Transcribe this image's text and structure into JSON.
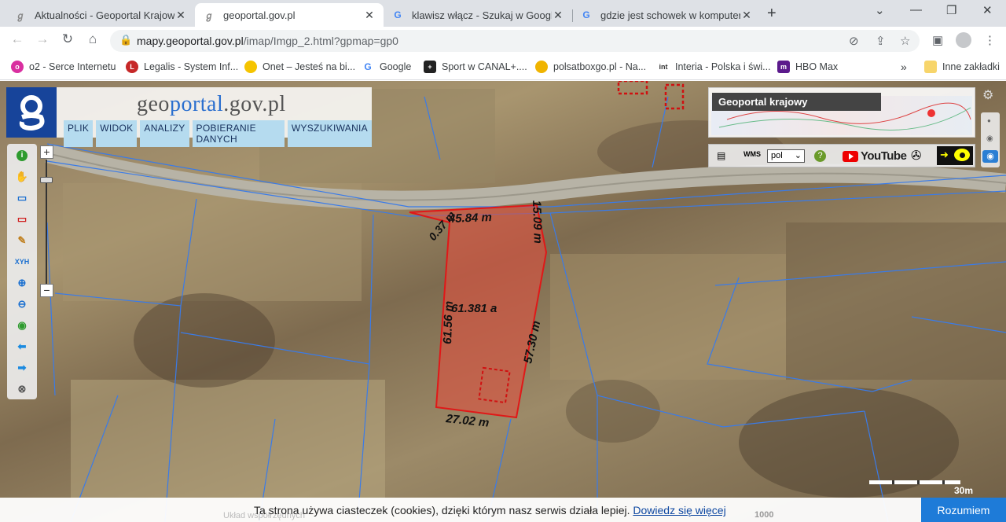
{
  "tabs": [
    {
      "title": "Aktualności - Geoportal Krajowy",
      "favicon": "geoportal-icon",
      "active": false
    },
    {
      "title": "geoportal.gov.pl",
      "favicon": "geoportal-icon",
      "active": true
    },
    {
      "title": "klawisz włącz - Szukaj w Google",
      "favicon": "google-icon",
      "active": false
    },
    {
      "title": "gdzie jest schowek w komputerze",
      "favicon": "google-icon",
      "active": false
    }
  ],
  "address_bar": {
    "host": "mapy.geoportal.gov.pl",
    "path": "/imap/Imgp_2.html?gpmap=gp0"
  },
  "bookmarks": [
    {
      "label": "o2 - Serce Internetu",
      "icon": "o2-icon",
      "color": "#d92fa0"
    },
    {
      "label": "Legalis - System Inf...",
      "icon": "legalis-icon",
      "color": "#c62828"
    },
    {
      "label": "Onet – Jesteś na bi...",
      "icon": "onet-icon",
      "color": "#f5c400"
    },
    {
      "label": "Google",
      "icon": "google-icon",
      "color": "#4285f4"
    },
    {
      "label": "Sport w CANAL+....",
      "icon": "canal-icon",
      "color": "#222222"
    },
    {
      "label": "polsatboxgo.pl - Na...",
      "icon": "polsat-icon",
      "color": "#f0b400"
    },
    {
      "label": "Interia - Polska i świ...",
      "icon": "interia-icon",
      "color": "#333333"
    },
    {
      "label": "HBO Max",
      "icon": "hbo-icon",
      "color": "#5b1a8c"
    }
  ],
  "other_bookmarks": "Inne zakładki",
  "geoportal": {
    "logo_text_prefix": "geo",
    "logo_text_highlight": "portal",
    "logo_text_suffix": ".gov.pl",
    "menu": [
      "PLIK",
      "WIDOK",
      "ANALIZY",
      "POBIERANIE DANYCH",
      "WYSZUKIWANIA"
    ],
    "overview_title": "Geoportal krajowy",
    "language": "pol",
    "youtube_label": "YouTube"
  },
  "plot": {
    "area": "61.381 a",
    "edges": [
      "45.84 m",
      "15.09 m",
      "57.30 m",
      "27.02 m",
      "61.56 m",
      "0.37 m"
    ]
  },
  "scale": "30m",
  "scale_ratio": "1000",
  "cookie": {
    "text": "Ta strona używa ciasteczek (cookies), dzięki którym nasz serwis działa lepiej.",
    "link": "Dowiedz się więcej",
    "button": "Rozumiem",
    "underlay": "Układ współrzędnych"
  },
  "colors": {
    "plot_fill": "#e0503f",
    "parcel_lines": "#3a7be8",
    "logo_blue": "#17449a"
  }
}
